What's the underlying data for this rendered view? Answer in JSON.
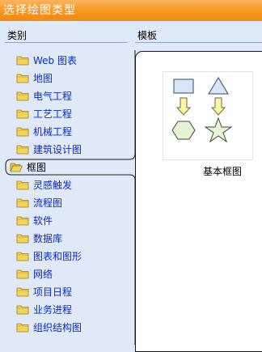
{
  "window": {
    "title": "选择绘图类型"
  },
  "categories_header": "类别",
  "templates_header": "模板",
  "categories": [
    {
      "label": "Web 图表",
      "selected": false
    },
    {
      "label": "地图",
      "selected": false
    },
    {
      "label": "电气工程",
      "selected": false
    },
    {
      "label": "工艺工程",
      "selected": false
    },
    {
      "label": "机械工程",
      "selected": false
    },
    {
      "label": "建筑设计图",
      "selected": false
    },
    {
      "label": "框图",
      "selected": true
    },
    {
      "label": "灵感触发",
      "selected": false
    },
    {
      "label": "流程图",
      "selected": false
    },
    {
      "label": "软件",
      "selected": false
    },
    {
      "label": "数据库",
      "selected": false
    },
    {
      "label": "图表和图形",
      "selected": false
    },
    {
      "label": "网络",
      "selected": false
    },
    {
      "label": "项目日程",
      "selected": false
    },
    {
      "label": "业务进程",
      "selected": false
    },
    {
      "label": "组织结构图",
      "selected": false
    }
  ],
  "templates": [
    {
      "label": "基本框图",
      "icon": "basic-block-diagram-thumbnail"
    }
  ],
  "colors": {
    "title_bar": "#f7941d",
    "background": "#dfe9f7",
    "category_text": "#0b2bbd",
    "folder": "#f6d455"
  }
}
